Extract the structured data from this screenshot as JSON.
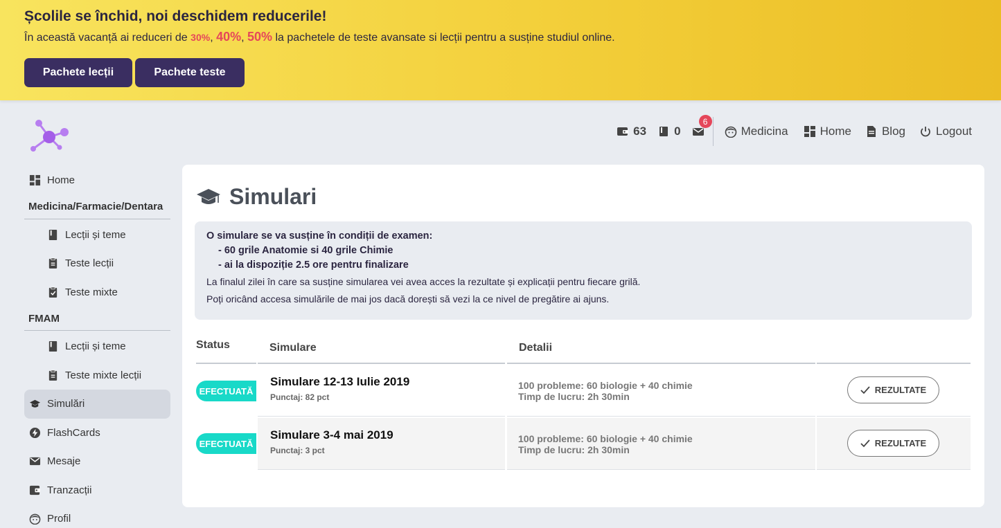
{
  "promo": {
    "title": "Școlile se închid, noi deschidem reducerile!",
    "text_before": "În această vacanță ai reduceri de ",
    "pct1": "30%",
    "pct2": "40%",
    "pct3": "50%",
    "text_after": " la pachetele de teste avansate si lecții pentru a susține studiul online.",
    "btn_lessons": "Pachete lecții",
    "btn_tests": "Pachete teste"
  },
  "topnav": {
    "wallet": "63",
    "books": "0",
    "mail_badge": "6",
    "profile": "Medicina",
    "home": "Home",
    "blog": "Blog",
    "logout": "Logout"
  },
  "sidebar": {
    "home": "Home",
    "section1": "Medicina/Farmacie/Dentara",
    "s1_items": [
      "Lecții și teme",
      "Teste lecții",
      "Teste mixte"
    ],
    "section2": "FMAM",
    "s2_items": [
      "Lecții și teme",
      "Teste mixte lecții"
    ],
    "simulari": "Simulări",
    "flashcards": "FlashCards",
    "mesaje": "Mesaje",
    "tranzactii": "Tranzacții",
    "profil": "Profil"
  },
  "main": {
    "title": "Simulari",
    "info": {
      "line1": "O simulare se va susține în condiții de examen:",
      "bullet1": "- 60 grile Anatomie si 40 grile Chimie",
      "bullet2": "- ai la dispoziție 2.5 ore pentru finalizare",
      "p1": "La finalul zilei în care sa susține simularea vei avea acces la rezultate și explicații pentru fiecare grilă.",
      "p2": "Poți oricând accesa simulările de mai jos dacă dorești să vezi la ce nivel de pregătire ai ajuns."
    },
    "table": {
      "headers": {
        "status": "Status",
        "simulare": "Simulare",
        "detalii": "Detalii"
      },
      "rows": [
        {
          "status": "EFECTUATĂ",
          "title": "Simulare 12-13 Iulie 2019",
          "score": "Punctaj: 82 pct",
          "det1": "100 probleme: 60 biologie + 40 chimie",
          "det2": "Timp de lucru: 2h 30min",
          "action": "REZULTATE"
        },
        {
          "status": "EFECTUATĂ",
          "title": "Simulare 3-4 mai 2019",
          "score": "Punctaj: 3 pct",
          "det1": "100 probleme: 60 biologie + 40 chimie",
          "det2": "Timp de lucru: 2h 30min",
          "action": "REZULTATE"
        }
      ]
    }
  },
  "colors": {
    "accent": "#3a2e61",
    "badge": "#18d9c8",
    "sale": "#e5465a"
  }
}
